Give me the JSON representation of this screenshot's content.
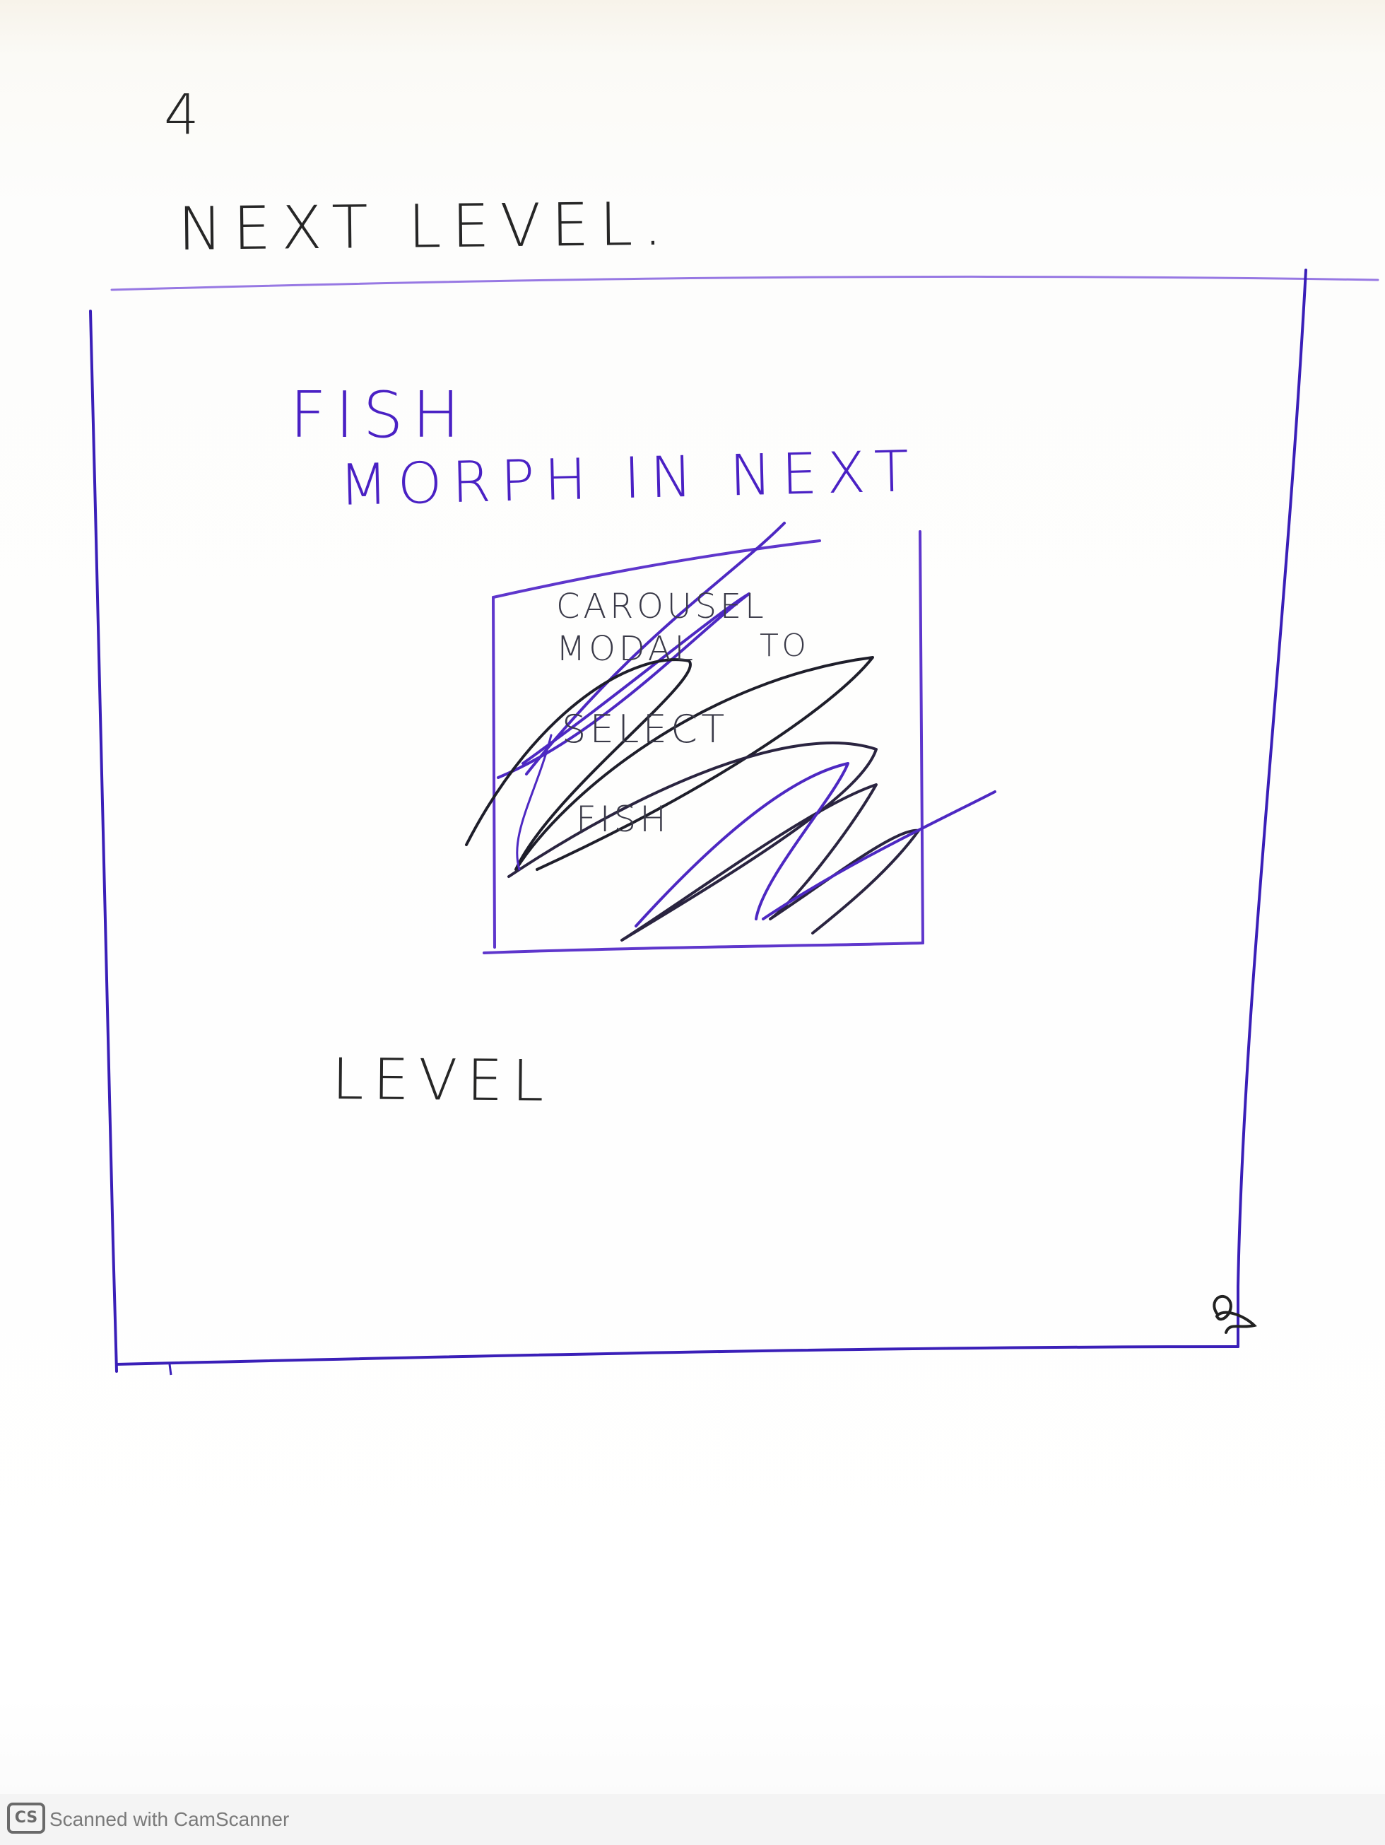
{
  "sketch": {
    "page_number": "4",
    "heading": "NEXT LEVEL.",
    "note_lines": [
      "FISH",
      "MORPH IN NEXT",
      "LEVEL"
    ],
    "struck_out_notes": [
      "CAROUSEL",
      "MODAL",
      "TO",
      "SELECT",
      "FISH"
    ],
    "ink_colors": {
      "black": "#262626",
      "purple": "#4a21c4"
    }
  },
  "footer": {
    "logo_text": "CS",
    "watermark_text": "Scanned with CamScanner"
  }
}
